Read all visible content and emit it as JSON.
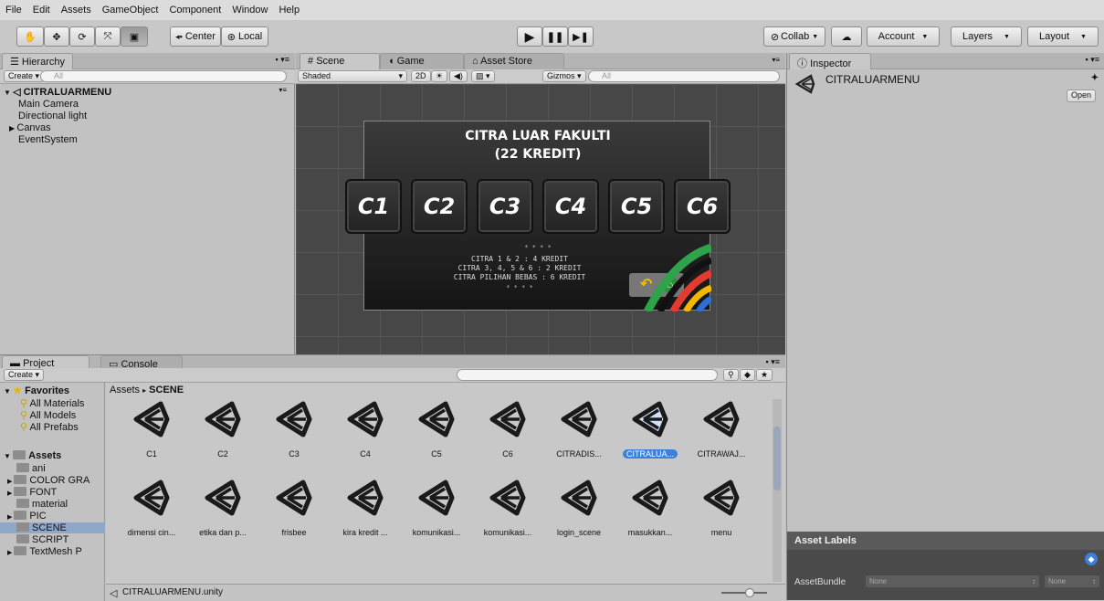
{
  "menu": [
    "File",
    "Edit",
    "Assets",
    "GameObject",
    "Component",
    "Window",
    "Help"
  ],
  "toolbar": {
    "center": "Center",
    "local": "Local",
    "collab": "Collab",
    "account": "Account",
    "layers": "Layers",
    "layout": "Layout"
  },
  "hierarchy": {
    "tab": "Hierarchy",
    "create": "Create",
    "search": "All",
    "scene_name": "CITRALUARMENU",
    "items": [
      "Main Camera",
      "Directional light",
      "Canvas",
      "EventSystem"
    ]
  },
  "scene": {
    "tabs": [
      "Scene",
      "Game",
      "Asset Store"
    ],
    "shading": "Shaded",
    "mode_2d": "2D",
    "gizmos": "Gizmos",
    "search": "All",
    "canvas": {
      "title_line1": "CITRA LUAR FAKULTI",
      "title_line2": "(22 KREDIT)",
      "buttons": [
        "C1",
        "C2",
        "C3",
        "C4",
        "C5",
        "C6"
      ],
      "stars_top": "* * * *",
      "info_line1": "CITRA 1 & 2 : 4 KREDIT",
      "info_line2": "CITRA 3, 4, 5 & 6 : 2 KREDIT",
      "info_line3": "CITRA PILIHAN BEBAS : 6 KREDIT",
      "stars_bottom": "* * * *"
    }
  },
  "inspector": {
    "tab": "Inspector",
    "object_name": "CITRALUARMENU",
    "open": "Open",
    "asset_labels": "Asset Labels",
    "asset_bundle_label": "AssetBundle",
    "asset_bundle_value": "None",
    "asset_bundle_variant": "None"
  },
  "project": {
    "tabs": [
      "Project",
      "Console"
    ],
    "create": "Create",
    "breadcrumb_root": "Assets",
    "breadcrumb_sep": "▸",
    "breadcrumb_current": "SCENE",
    "favorites": "Favorites",
    "favorite_items": [
      "All Materials",
      "All Models",
      "All Prefabs"
    ],
    "assets_root": "Assets",
    "folders": [
      "ani",
      "COLOR GRA",
      "FONT",
      "material",
      "PIC",
      "SCENE",
      "SCRIPT",
      "TextMesh P"
    ],
    "row1": [
      "C1",
      "C2",
      "C3",
      "C4",
      "C5",
      "C6",
      "CITRADIS...",
      "CITRALUA...",
      "CITRAWAJ..."
    ],
    "row2": [
      "dimensi cin...",
      "etika dan p...",
      "frisbee",
      "kira kredit ...",
      "komunikasi...",
      "komunikasi...",
      "login_scene",
      "masukkan...",
      "menu"
    ],
    "selected_index": 7,
    "status_file": "CITRALUARMENU.unity"
  },
  "colors": {
    "selection": "#3d7fd9",
    "panel": "#c2c2c2",
    "scene_bg": "#474747"
  }
}
